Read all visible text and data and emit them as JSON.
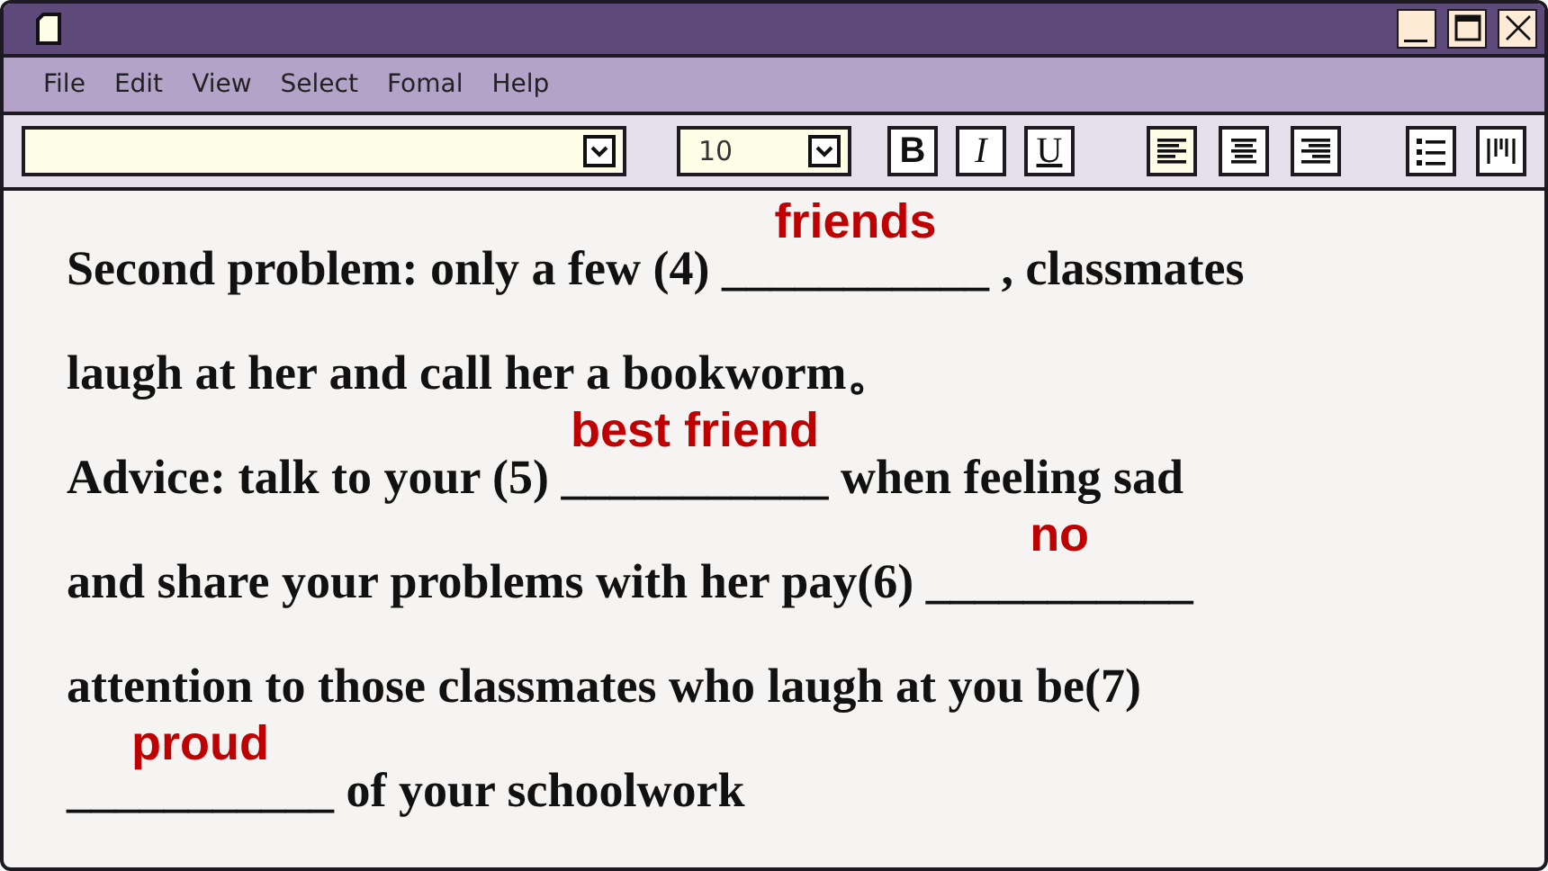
{
  "menu": [
    "File",
    "Edit",
    "View",
    "Select",
    "Fomal",
    "Help"
  ],
  "toolbar": {
    "font_size": "10",
    "format_buttons": [
      {
        "label": "B",
        "kind": "bold"
      },
      {
        "label": "I",
        "kind": "italic"
      },
      {
        "label": "U",
        "kind": "underline"
      }
    ],
    "align_buttons": [
      {
        "kind": "left",
        "selected": true
      },
      {
        "kind": "center",
        "selected": false
      },
      {
        "kind": "right",
        "selected": false
      }
    ]
  },
  "lines": [
    [
      {
        "kind": "text",
        "text": "Second problem: only a few (4) "
      },
      {
        "kind": "blank",
        "text": "___________",
        "answer": "friends"
      },
      {
        "kind": "text",
        "text": " , classmates"
      }
    ],
    [
      {
        "kind": "text",
        "text": "laugh at her and call her a bookworm。"
      }
    ],
    [
      {
        "kind": "text",
        "text": "Advice: talk to your (5) "
      },
      {
        "kind": "blank",
        "text": "___________",
        "answer": "best friend"
      },
      {
        "kind": "text",
        "text": " when feeling sad"
      }
    ],
    [
      {
        "kind": "text",
        "text": "and share your problems with her pay(6) "
      },
      {
        "kind": "blank",
        "text": "___________",
        "answer": "no"
      }
    ],
    [
      {
        "kind": "text",
        "text": "attention to those classmates who laugh at you be(7)"
      }
    ],
    [
      {
        "kind": "blank",
        "text": "___________",
        "answer": "proud"
      },
      {
        "kind": "text",
        "text": " of your schoolwork"
      }
    ]
  ]
}
